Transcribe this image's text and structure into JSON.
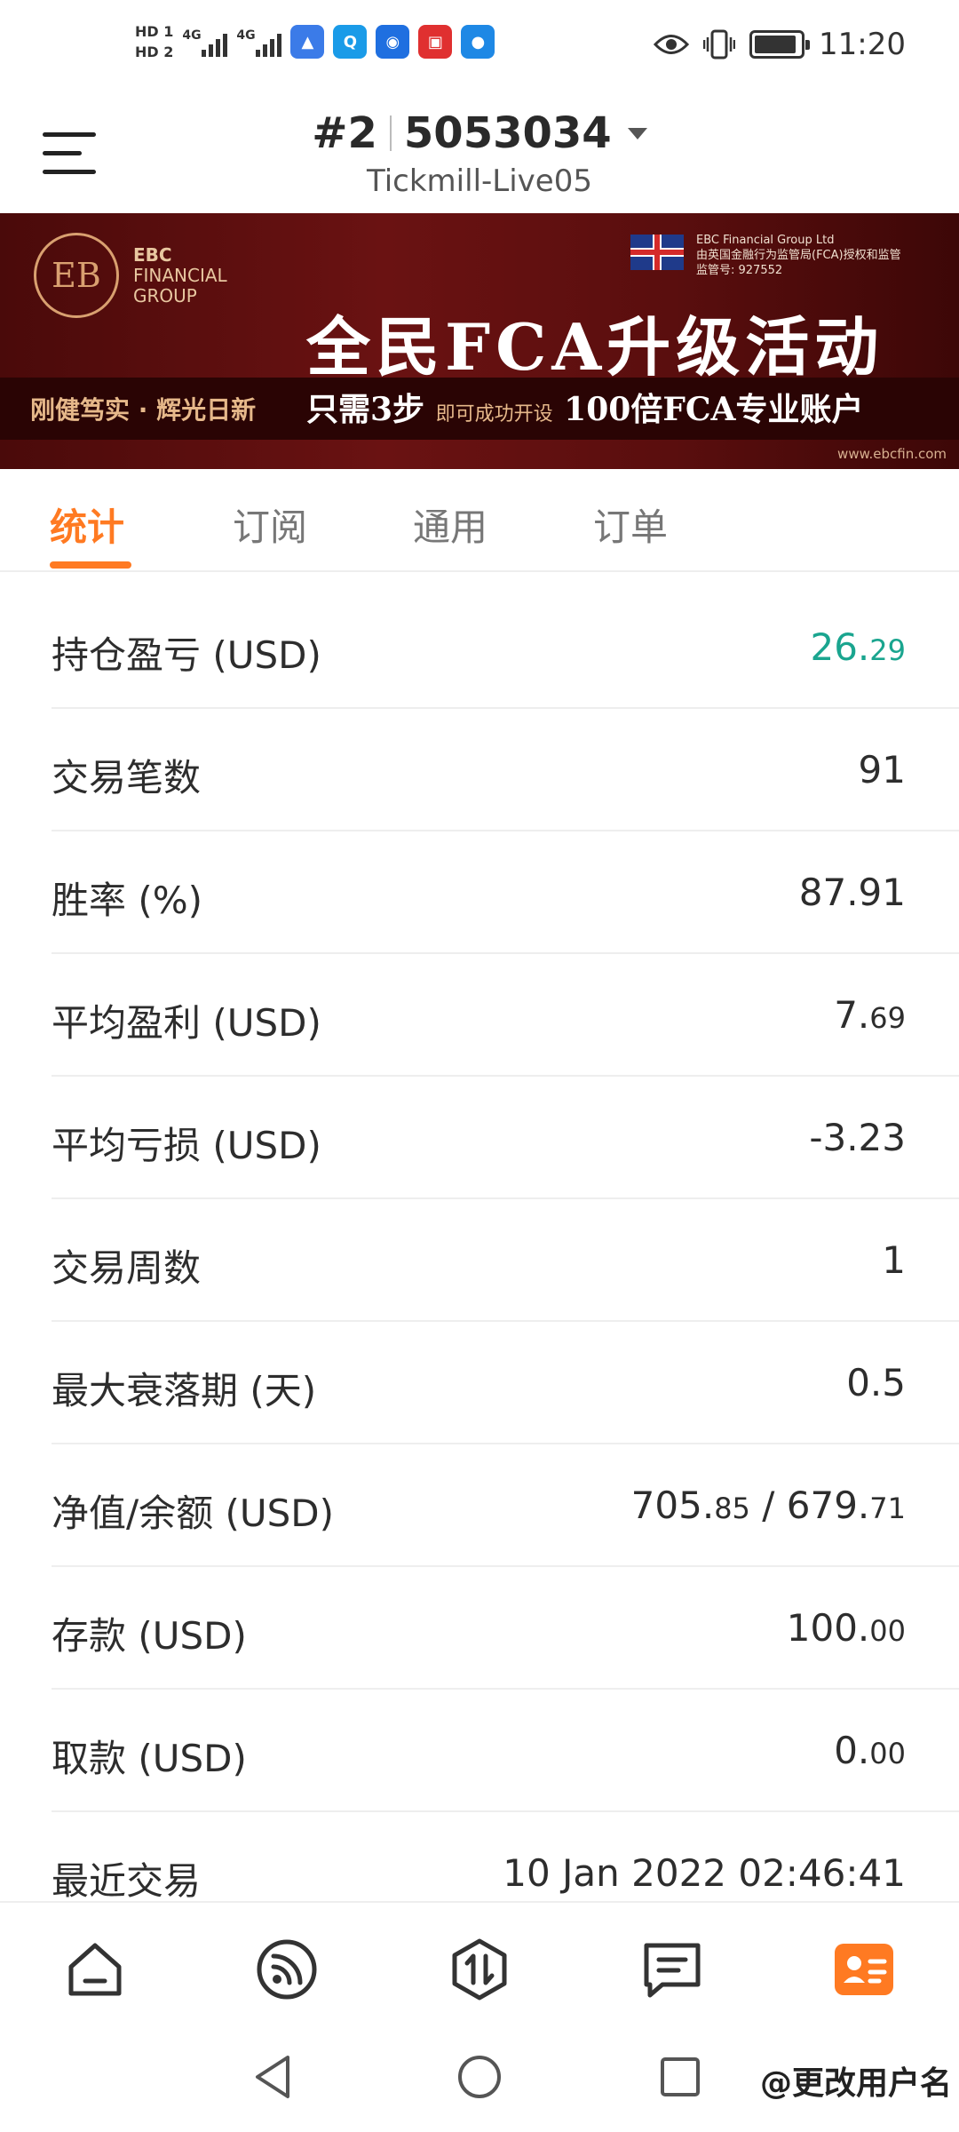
{
  "status_bar": {
    "sim1": "HD 1",
    "sim2": "HD 2",
    "network": "4G",
    "time": "11:20",
    "icons": [
      "eye-icon",
      "vibrate-icon",
      "battery-charging-icon"
    ]
  },
  "header": {
    "account_index": "#2",
    "account_number": "5053034",
    "server": "Tickmill-Live05"
  },
  "banner": {
    "brand_line1": "EBC",
    "brand_line2": "FINANCIAL",
    "brand_line3": "GROUP",
    "fca_line1": "EBC Financial Group Ltd",
    "fca_line2": "由英国金融行为监管局(FCA)授权和监管",
    "fca_line3": "监管号: 927552",
    "title": "全民FCA升级活动",
    "slogan": "刚健笃实 · 辉光日新",
    "promo_main": "只需3步",
    "promo_small": "即可成功开设",
    "promo_end": "100倍FCA专业账户",
    "url": "www.ebcfin.com"
  },
  "tabs": [
    {
      "label": "统计",
      "active": true
    },
    {
      "label": "订阅",
      "active": false
    },
    {
      "label": "通用",
      "active": false
    },
    {
      "label": "订单",
      "active": false
    }
  ],
  "stats": [
    {
      "label": "持仓盈亏 (USD)",
      "value_main": "26.",
      "value_small": "29",
      "positive": true
    },
    {
      "label": "交易笔数",
      "value_main": "91",
      "value_small": ""
    },
    {
      "label": "胜率 (%)",
      "value_main": "87.91",
      "value_small": ""
    },
    {
      "label": "平均盈利 (USD)",
      "value_main": "7.",
      "value_small": "69"
    },
    {
      "label": "平均亏损 (USD)",
      "value_main": "-3.23",
      "value_small": ""
    },
    {
      "label": "交易周数",
      "value_main": "1",
      "value_small": ""
    },
    {
      "label": "最大衰落期 (天)",
      "value_main": "0.5",
      "value_small": ""
    },
    {
      "label": "净值/余额 (USD)",
      "value_main": "705.",
      "value_small": "85",
      "value_main2": " / 679.",
      "value_small2": "71"
    },
    {
      "label": "存款 (USD)",
      "value_main": "100.",
      "value_small": "00"
    },
    {
      "label": "取款 (USD)",
      "value_main": "0.",
      "value_small": "00"
    },
    {
      "label": "最近交易",
      "value_main": "10 Jan 2022 02:46:41",
      "value_small": ""
    }
  ],
  "bottom_nav": [
    "home-icon",
    "feed-icon",
    "trade-icon",
    "orders-icon",
    "profile-icon"
  ],
  "accent_color": "#ff7a22",
  "positive_color": "#1aa58f",
  "watermark": "@更改用户名"
}
